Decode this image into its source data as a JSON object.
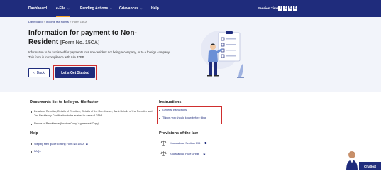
{
  "nav": {
    "items": [
      {
        "label": "Dashboard",
        "has_dropdown": false,
        "active": false
      },
      {
        "label": "e-File",
        "has_dropdown": true,
        "active": true
      },
      {
        "label": "Pending Actions",
        "has_dropdown": true,
        "active": false
      },
      {
        "label": "Grievances",
        "has_dropdown": true,
        "active": false
      },
      {
        "label": "Help",
        "has_dropdown": false,
        "active": false
      }
    ],
    "session_label": "Session Time",
    "session_digits": [
      "1",
      "5",
      "5",
      "6"
    ]
  },
  "breadcrumb": {
    "items": [
      "Dashboard",
      "Income tax Forms",
      "Form 15CA"
    ]
  },
  "hero": {
    "title": "Information for payment to Non-Resident",
    "form_tag": "[Form No. 15CA]",
    "description": "Information to be furnished for payments to a non-resident not being a company, or to a foreign company This form is in compliance with rule 37BB.",
    "back_label": "Back",
    "start_label": "Let's Get Started"
  },
  "documents": {
    "heading": "Documents list to help you file faster",
    "items": [
      "Details of Remitter, Details of Remittee, Details of the Remittance, Bank Details of the Remitter and Tax Residency Certification to be availed in case of DTAA.",
      "Nature of Remittance (Invoice Copy/ Agreement Copy)."
    ]
  },
  "help": {
    "heading": "Help",
    "links": [
      "Step by step guide to filing Form No 15CA",
      "FAQs"
    ]
  },
  "instructions": {
    "heading": "Instructions",
    "links": [
      "General Instructions",
      "Things you should know before filing"
    ]
  },
  "law": {
    "heading": "Provisions of the law",
    "links": [
      "Know about Section 195",
      "Know about Rule 37BB"
    ]
  },
  "chat": {
    "label": "Chatbot"
  },
  "colors": {
    "nav": "#1f2c7c",
    "accent": "#f3a227",
    "highlight": "#cf2e2e",
    "hero_bg": "#f2f4fa"
  }
}
